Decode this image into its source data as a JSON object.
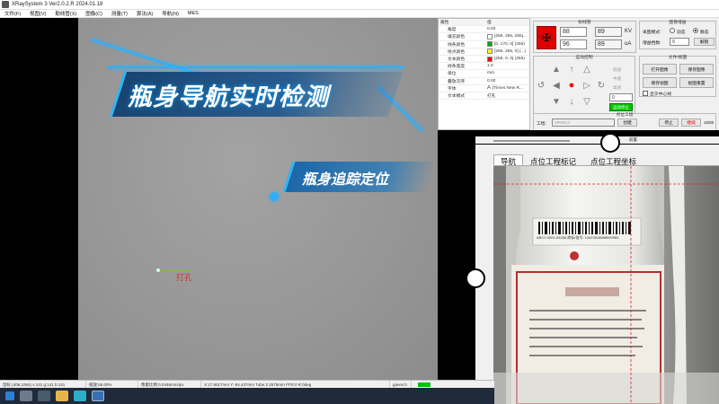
{
  "window": {
    "title": "XRaySystem 3 Ver2.0.2.R 2024.01.18"
  },
  "menu": [
    "文件(F)",
    "视图(V)",
    "勒线管(X)",
    "图像(C)",
    "测量(T)",
    "算法(A)",
    "导航(N)",
    "MES"
  ],
  "banners": {
    "main": "瓶身导航实时检测",
    "sub": "瓶身追踪定位"
  },
  "annotation": {
    "text": "打孔"
  },
  "properties": {
    "header": {
      "key": "属性",
      "value": "值"
    },
    "rows": [
      {
        "key": "角度",
        "value": "0.00"
      },
      {
        "key": "填充颜色",
        "value": "[255, 255, 255]...",
        "swatch": ""
      },
      {
        "key": "线条颜色",
        "value": "[0, 170, 0] (255)",
        "swatch": "#00aa00"
      },
      {
        "key": "绘点颜色",
        "value": "[255, 255, 0] (...)",
        "swatch": "#ffff00"
      },
      {
        "key": "文本颜色",
        "value": "[255, 0, 0] (255)",
        "swatch": "#ff0000"
      },
      {
        "key": "线条宽度",
        "value": "1.0"
      },
      {
        "key": "单位",
        "value": "mm"
      },
      {
        "key": "叠放次序",
        "value": "0.00"
      },
      {
        "key": "字体",
        "value": "[Times New R...",
        "icon": "A"
      },
      {
        "key": "文本模式",
        "value": "打孔"
      }
    ]
  },
  "xray": {
    "title": "射线管",
    "kv_set": "88",
    "kv_act": "89",
    "kv_unit": "KV",
    "ua_set": "96",
    "ua_act": "89",
    "ua_unit": "uA"
  },
  "image_acq": {
    "title": "图像增益",
    "mode_label": "采图模式:",
    "dynamic": "动态",
    "static": "静态",
    "gain_label": "增益档数:",
    "gain_value": "9",
    "unlock": "解锁"
  },
  "motion": {
    "title": "运动控制",
    "speed_options": [
      "低速",
      "中速",
      "高速"
    ],
    "position": "0",
    "status": "运动停止"
  },
  "file_view": {
    "title": "文件/视图",
    "buttons": [
      "打开图像",
      "保存图像",
      "保存视图",
      "视图重置"
    ],
    "center_line": "显示中心线"
  },
  "project": {
    "title": "点位工程",
    "label": "工程:",
    "selected": "MR0913",
    "create": "创建",
    "stop": "停止",
    "continue": "继续",
    "progress": "16/80"
  },
  "nav_bar_label": "前置",
  "camera_tabs": [
    "导航",
    "点位工程标记",
    "点位工程坐标"
  ],
  "camera_label": "ABC0-0001-83256   商标/批号: 13423518888000983",
  "statusbar": [
    "鼠标 (406,1064) v:141 g:141 b:141",
    "缩放:65.00%",
    "像素比例:0.0446mm/pix",
    "X:17.8017mm  Y:-94.437mm  Tube:2.2575mm  FPS:0  R:0deg",
    "gaves:0"
  ],
  "colors": {
    "accent": "#28b6ff",
    "red_button": "#e00000",
    "green_status": "#00c400"
  }
}
